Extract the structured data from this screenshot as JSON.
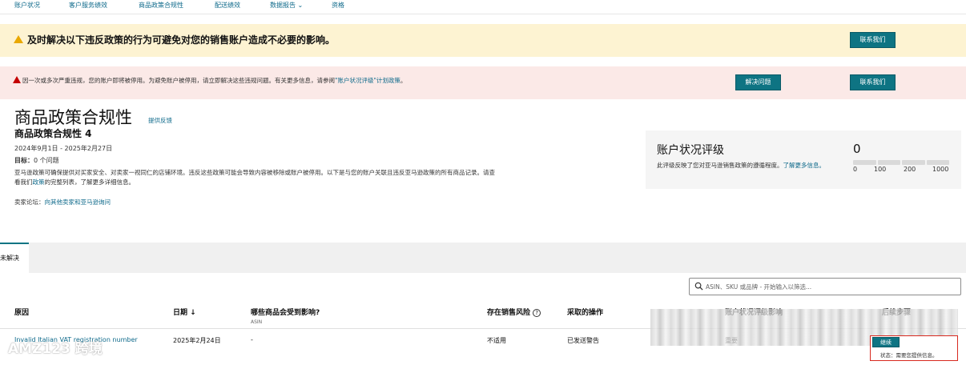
{
  "nav": {
    "items": [
      "账户状况",
      "客户服务绩效",
      "商品政策合规性",
      "配送绩效",
      "数据报告 ⌄",
      "资格"
    ]
  },
  "warning_banner": {
    "text": "及时解决以下违反政策的行为可避免对您的销售账户造成不必要的影响。",
    "contact_button": "联系我们"
  },
  "error_banner": {
    "text": "因一次或多次严重违规，您的账户即将被停用。为避免账户被停用，请立即解决这些违规问题。有关更多信息，请参阅",
    "link": "\"账户状况评级\"计划政策",
    "text_end": "。",
    "resolve_button": "解决问题",
    "contact_button": "联系我们"
  },
  "header": {
    "title": "商品政策合规性",
    "feedback": "提供反馈",
    "subtitle": "商品政策合规性 4",
    "date_range": "2024年9月1日 - 2025年2月27日",
    "target_label": "目标：",
    "target_value": "0 个问题",
    "description_1": "亚马逊政策可确保提供对买家安全、对卖家一视同仁的店铺环境。违反这些政策可能会导致内容被移除或账户被停用。以下是与您的账户关联且违反亚马逊政策的所有商品记录。请查看我们",
    "description_link": "政策",
    "description_2": "的完整列表，了解更多详细信息。",
    "forum_label": "卖家论坛：",
    "forum_link": "向其他卖家和亚马逊询问"
  },
  "health_card": {
    "title": "账户状况评级",
    "description": "此评级反映了您对亚马逊销售政策的遵循程度。",
    "learn_more": "了解更多信息。",
    "score": "0",
    "scale": [
      "0",
      "100",
      "200",
      "1000"
    ]
  },
  "tabs": {
    "active": "未解决"
  },
  "search": {
    "placeholder": "ASIN、SKU 或品牌 - 开始输入以筛选..."
  },
  "table": {
    "headers": {
      "reason": "原因",
      "date": "日期 ↓",
      "affected": "哪些商品会受到影响?",
      "affected_sub": "ASIN",
      "risk": "存在销售风险",
      "action": "采取的操作",
      "impact": "账户状况评级影响",
      "next": "后续步骤"
    },
    "rows": [
      {
        "reason": "Invalid Italian VAT registration number",
        "date": "2025年2月24日",
        "affected": "-",
        "risk": "不适用",
        "action": "已发送警告",
        "impact": "重要",
        "next_button": "继续",
        "status": "状态：需要您提供信息。"
      }
    ]
  },
  "watermark": {
    "text": "AMZ123 跨境"
  },
  "colors": {
    "teal": "#0e7483",
    "link": "#0f6a8b",
    "warning_bg": "#fdf3d2",
    "error_bg": "#fbe9e7",
    "warning_icon": "#e9a800",
    "error_icon": "#c40000",
    "highlight_border": "#d8291f"
  }
}
